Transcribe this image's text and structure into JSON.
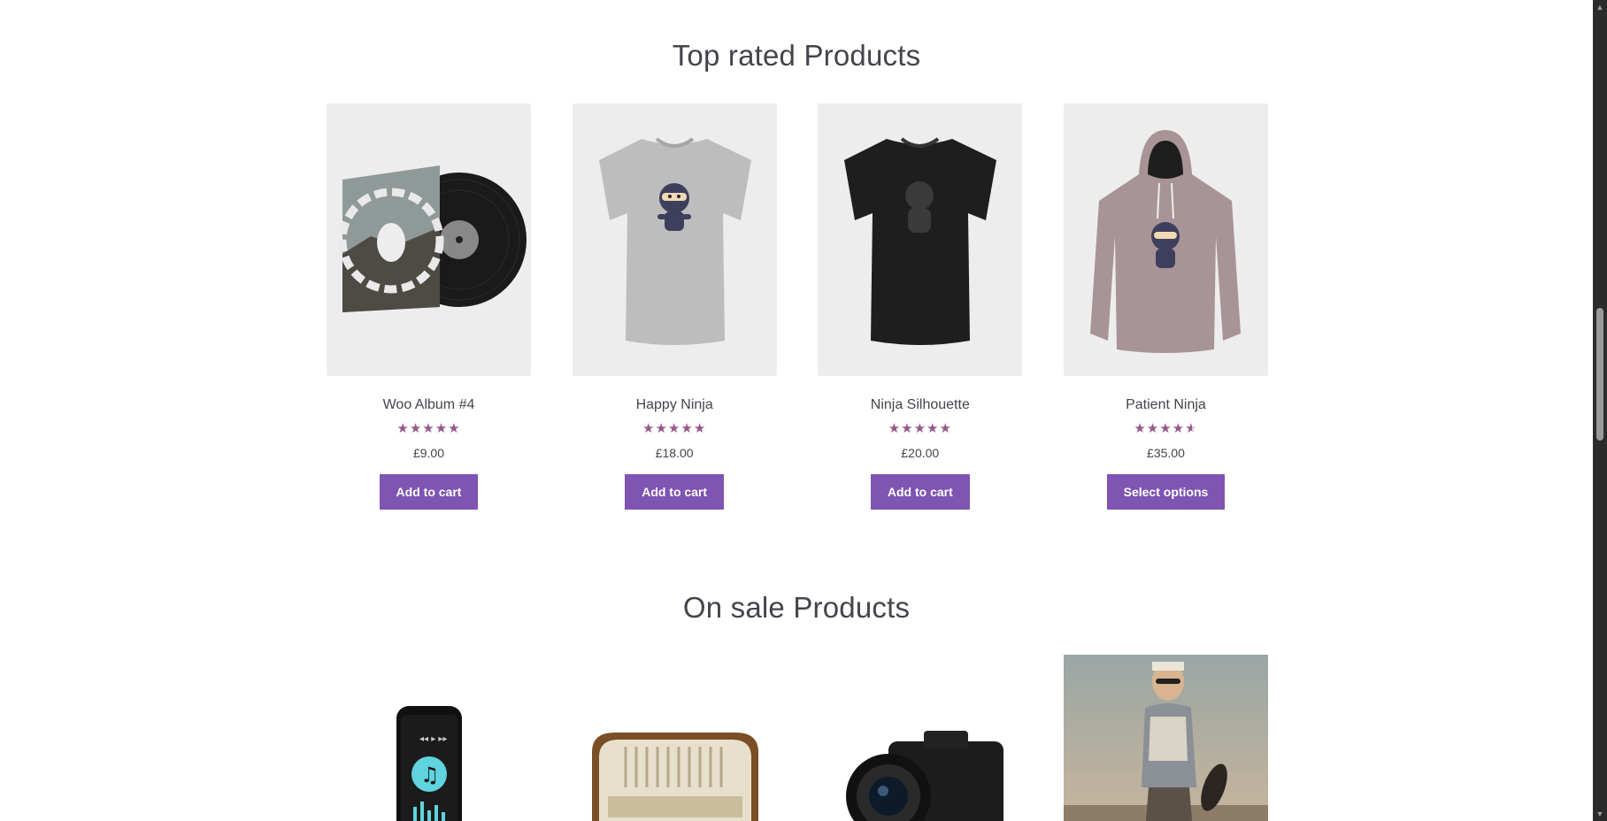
{
  "sections": {
    "top_rated": {
      "title": "Top rated Products",
      "products": [
        {
          "name": "Woo Album #4",
          "rating": 5,
          "stars_full": "★★★★★",
          "stars_half": "",
          "price": "£9.00",
          "button": "Add to cart",
          "image": "vinyl-album-image"
        },
        {
          "name": "Happy Ninja",
          "rating": 5,
          "stars_full": "★★★★★",
          "stars_half": "",
          "price": "£18.00",
          "button": "Add to cart",
          "image": "grey-ninja-tshirt-image"
        },
        {
          "name": "Ninja Silhouette",
          "rating": 5,
          "stars_full": "★★★★★",
          "stars_half": "",
          "price": "£20.00",
          "button": "Add to cart",
          "image": "black-ninja-tshirt-image"
        },
        {
          "name": "Patient Ninja",
          "rating": 4.5,
          "stars_full": "★★★★",
          "stars_half": "★",
          "price": "£35.00",
          "button": "Select options",
          "image": "pink-ninja-hoodie-image"
        }
      ]
    },
    "on_sale": {
      "title": "On sale Products",
      "products": [
        {
          "image": "smartphone-music-image"
        },
        {
          "image": "vintage-radio-image"
        },
        {
          "image": "dslr-camera-image"
        },
        {
          "image": "fashion-model-photo-image"
        }
      ]
    }
  },
  "colors": {
    "accent": "#7f54b3",
    "star": "#96588a",
    "text": "#43454b",
    "image_bg": "#ededed"
  }
}
